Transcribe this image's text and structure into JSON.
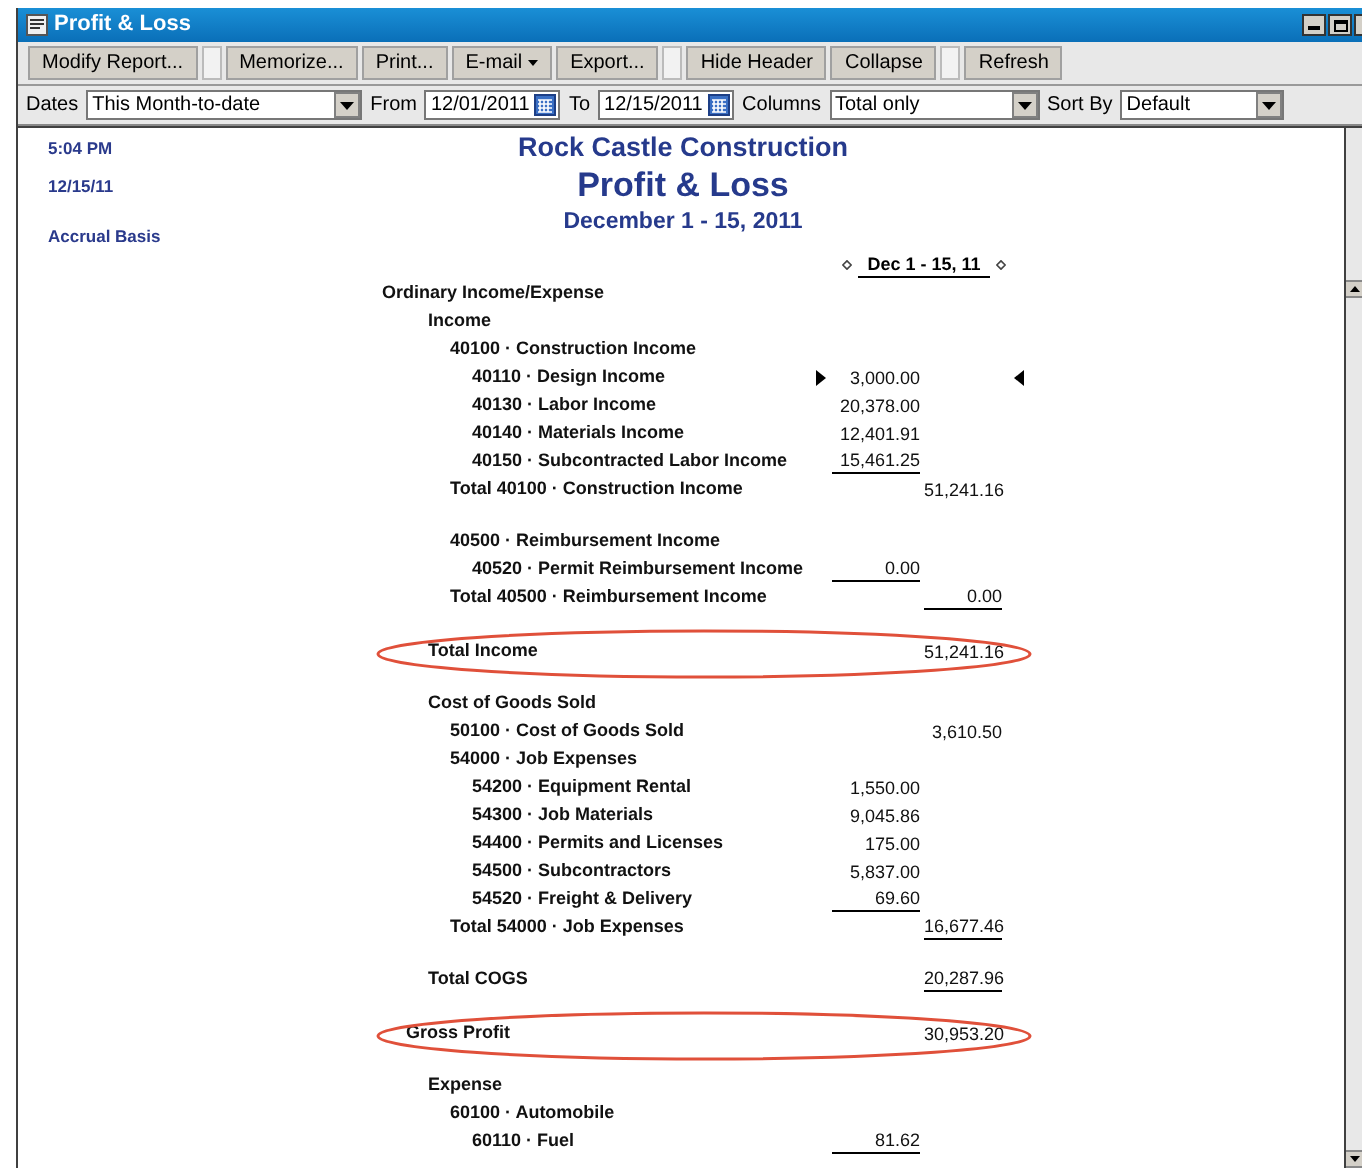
{
  "window": {
    "title": "Profit & Loss"
  },
  "toolbar": [
    {
      "label": "Modify Report...",
      "space_before": false,
      "caret": false
    },
    {
      "label": "Memorize...",
      "space_before": true,
      "caret": false
    },
    {
      "label": "Print...",
      "space_before": false,
      "caret": false
    },
    {
      "label": "E-mail",
      "space_before": false,
      "caret": true
    },
    {
      "label": "Export...",
      "space_before": false,
      "caret": false
    },
    {
      "label": "Hide Header",
      "space_before": true,
      "caret": false
    },
    {
      "label": "Collapse",
      "space_before": false,
      "caret": false
    },
    {
      "label": "Refresh",
      "space_before": true,
      "caret": false
    }
  ],
  "filters": [
    {
      "kind": "dropdown",
      "label": "Dates",
      "value": "This Month-to-date"
    },
    {
      "kind": "date",
      "label": "From",
      "value": "12/01/2011"
    },
    {
      "kind": "date",
      "label": "To",
      "value": "12/15/2011"
    },
    {
      "kind": "dropdown",
      "label": "Columns",
      "value": "Total only"
    },
    {
      "kind": "dropdown",
      "label": "Sort By",
      "value": "Default"
    }
  ],
  "report": {
    "time": "5:04 PM",
    "date": "12/15/11",
    "basis": "Accrual Basis",
    "company": "Rock Castle Construction",
    "title": "Profit & Loss",
    "period": "December 1 - 15, 2011",
    "column_header": "Dec 1 - 15, 11",
    "rows": [
      {
        "label": "Ordinary Income/Expense",
        "children": [
          {
            "label": "Income",
            "children": [
              {
                "label": "40100 · Construction Income",
                "children": [
                  {
                    "label": "40110 · Design Income",
                    "amount": "3,000.00",
                    "kind": "detail",
                    "underlined": false,
                    "selected": true
                  },
                  {
                    "label": "40130 · Labor Income",
                    "amount": "20,378.00",
                    "kind": "detail",
                    "underlined": false,
                    "selected": false
                  },
                  {
                    "label": "40140 · Materials Income",
                    "amount": "12,401.91",
                    "kind": "detail",
                    "underlined": false,
                    "selected": false
                  },
                  {
                    "label": "40150 · Subcontracted Labor Income",
                    "amount": "15,461.25",
                    "kind": "detail",
                    "underlined": true,
                    "selected": false
                  }
                ]
              },
              {
                "label": "Total 40100 · Construction Income",
                "amount": "51,241.16",
                "kind": "sum",
                "underlined": false,
                "selected": false
              },
              {
                "label": "40500 · Reimbursement Income",
                "space_before": true,
                "children": [
                  {
                    "label": "40520 · Permit Reimbursement Income",
                    "amount": "0.00",
                    "kind": "detail",
                    "underlined": true,
                    "selected": false
                  }
                ]
              },
              {
                "label": "Total 40500 · Reimbursement Income",
                "amount": "0.00",
                "kind": "sum",
                "underlined": true,
                "selected": false
              }
            ]
          },
          {
            "label": "Total Income",
            "amount": "51,241.16",
            "kind": "sum",
            "underlined": false,
            "space_before": true,
            "circled": true,
            "selected": false
          },
          {
            "label": "Cost of Goods Sold",
            "space_before": true,
            "children": [
              {
                "label": "50100 · Cost of Goods Sold",
                "amount": "3,610.50",
                "kind": "sum",
                "underlined": false,
                "selected": false
              },
              {
                "label": "54000 · Job Expenses",
                "children": [
                  {
                    "label": "54200 · Equipment Rental",
                    "amount": "1,550.00",
                    "kind": "detail",
                    "underlined": false,
                    "selected": false
                  },
                  {
                    "label": "54300 · Job Materials",
                    "amount": "9,045.86",
                    "kind": "detail",
                    "underlined": false,
                    "selected": false
                  },
                  {
                    "label": "54400 · Permits and Licenses",
                    "amount": "175.00",
                    "kind": "detail",
                    "underlined": false,
                    "selected": false
                  },
                  {
                    "label": "54500 · Subcontractors",
                    "amount": "5,837.00",
                    "kind": "detail",
                    "underlined": false,
                    "selected": false
                  },
                  {
                    "label": "54520 · Freight & Delivery",
                    "amount": "69.60",
                    "kind": "detail",
                    "underlined": true,
                    "selected": false
                  }
                ]
              },
              {
                "label": "Total 54000 · Job Expenses",
                "amount": "16,677.46",
                "kind": "sum",
                "underlined": true,
                "selected": false
              }
            ]
          },
          {
            "label": "Total COGS",
            "amount": "20,287.96",
            "kind": "sum",
            "underlined": true,
            "space_before": true,
            "selected": false
          },
          {
            "label": "Gross Profit",
            "kind": "profit",
            "amount": "30,953.20",
            "underlined": false,
            "space_before": true,
            "circled": true,
            "selected": false
          },
          {
            "label": "Expense",
            "space_before": true,
            "children": [
              {
                "label": "60100 · Automobile",
                "children": [
                  {
                    "label": "60110 · Fuel",
                    "amount": "81.62",
                    "kind": "detail",
                    "underlined": true,
                    "selected": false
                  }
                ]
              }
            ]
          }
        ]
      }
    ]
  }
}
